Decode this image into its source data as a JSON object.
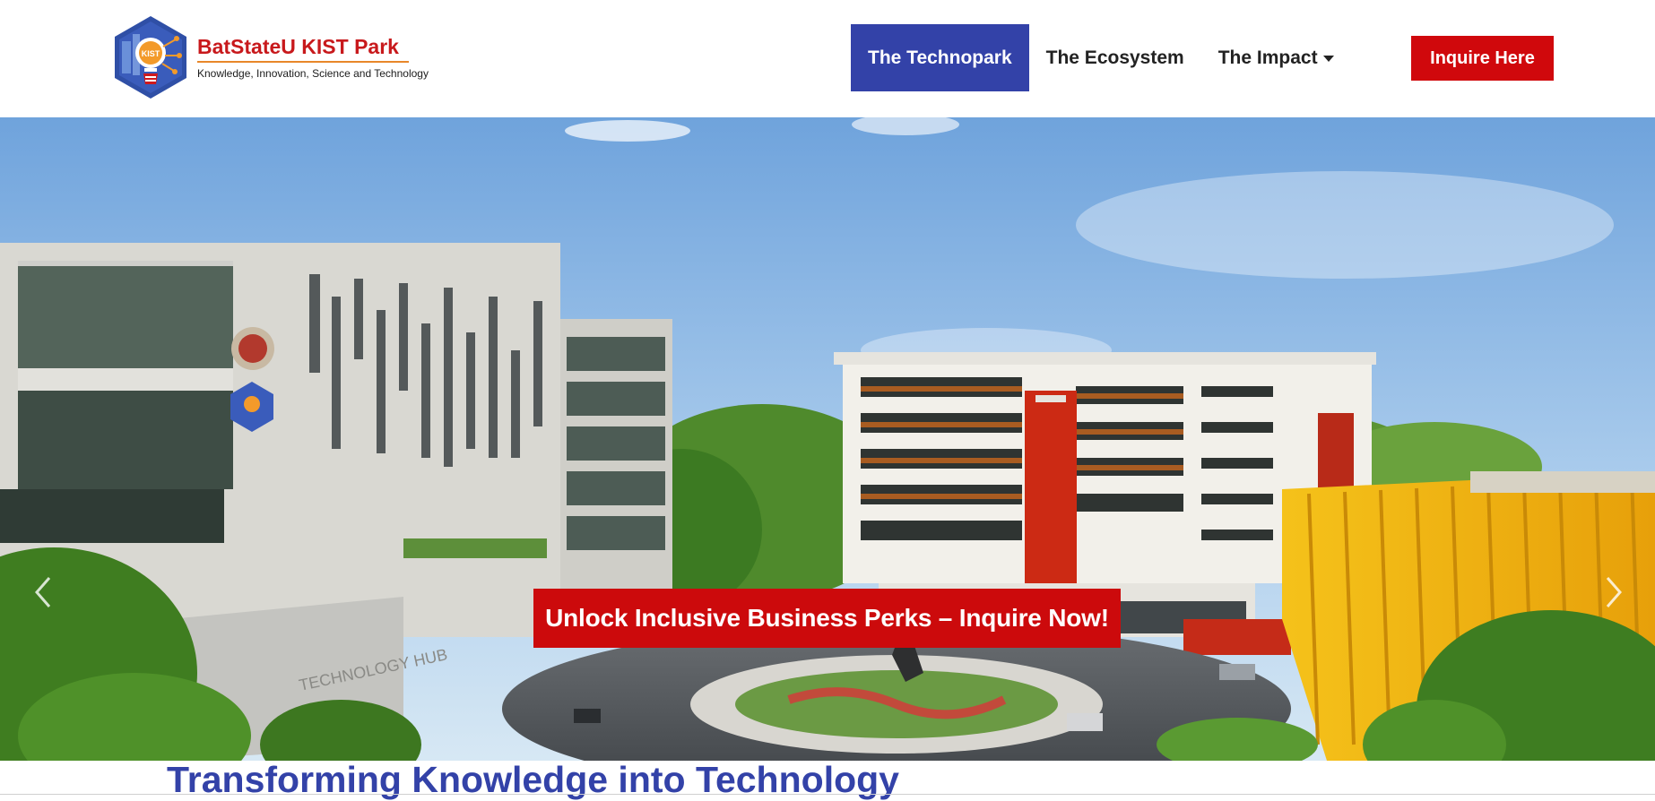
{
  "brand": {
    "name": "BatStateU KIST Park",
    "tagline": "Knowledge, Innovation, Science and Technology",
    "logo_text": "KIST"
  },
  "nav": {
    "items": [
      {
        "label": "The Technopark",
        "active": true
      },
      {
        "label": "The Ecosystem",
        "active": false
      },
      {
        "label": "The Impact",
        "active": false,
        "has_dropdown": true
      }
    ],
    "cta_label": "Inquire Here"
  },
  "hero": {
    "image": "campus-rendering",
    "building_sign": "TECHNOLOGY HUB",
    "cta_label": "Unlock Inclusive Business Perks – Inquire Now!",
    "prev_icon": "chevron-left-icon",
    "next_icon": "chevron-right-icon"
  },
  "section": {
    "title": "Transforming Knowledge into Technology"
  },
  "colors": {
    "primary_blue": "#3342a8",
    "accent_red": "#d0080c",
    "brand_red": "#c8191c",
    "brand_orange": "#e8872a"
  }
}
